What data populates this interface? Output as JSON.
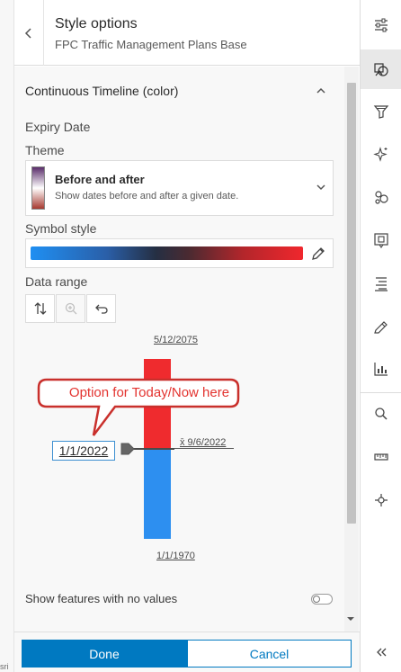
{
  "header": {
    "title": "Style options",
    "subtitle": "FPC Traffic Management Plans Base"
  },
  "edge_text": "sri",
  "style_block": {
    "title": "Continuous Timeline (color)",
    "field_label": "Expiry Date",
    "theme_label": "Theme",
    "theme": {
      "name": "Before and after",
      "description": "Show dates before and after a given date."
    },
    "symbol_style_label": "Symbol style",
    "data_range_label": "Data range",
    "histogram": {
      "max_label": "5/12/2075",
      "min_label": "1/1/1970",
      "average_label": "x̄ 9/6/2022",
      "handle_value": "1/1/2022"
    },
    "annotation": "Option for Today/Now here",
    "show_no_values_label": "Show features with no values",
    "show_no_values_enabled": false
  },
  "footer": {
    "done_label": "Done",
    "cancel_label": "Cancel"
  },
  "colors": {
    "accent": "#0079c1",
    "histogram_above": "#ef2b2e",
    "histogram_below": "#2d8ff0",
    "annotation": "#e3332f"
  },
  "toolbar": {
    "items": [
      "properties-icon",
      "styles-icon",
      "filter-icon",
      "effects-icon",
      "clustering-icon",
      "pop-ups-icon",
      "labels-icon",
      "sketch-icon",
      "analysis-icon",
      "search-icon",
      "measure-icon",
      "location-icon",
      "collapse-icon"
    ],
    "active": "styles-icon"
  }
}
